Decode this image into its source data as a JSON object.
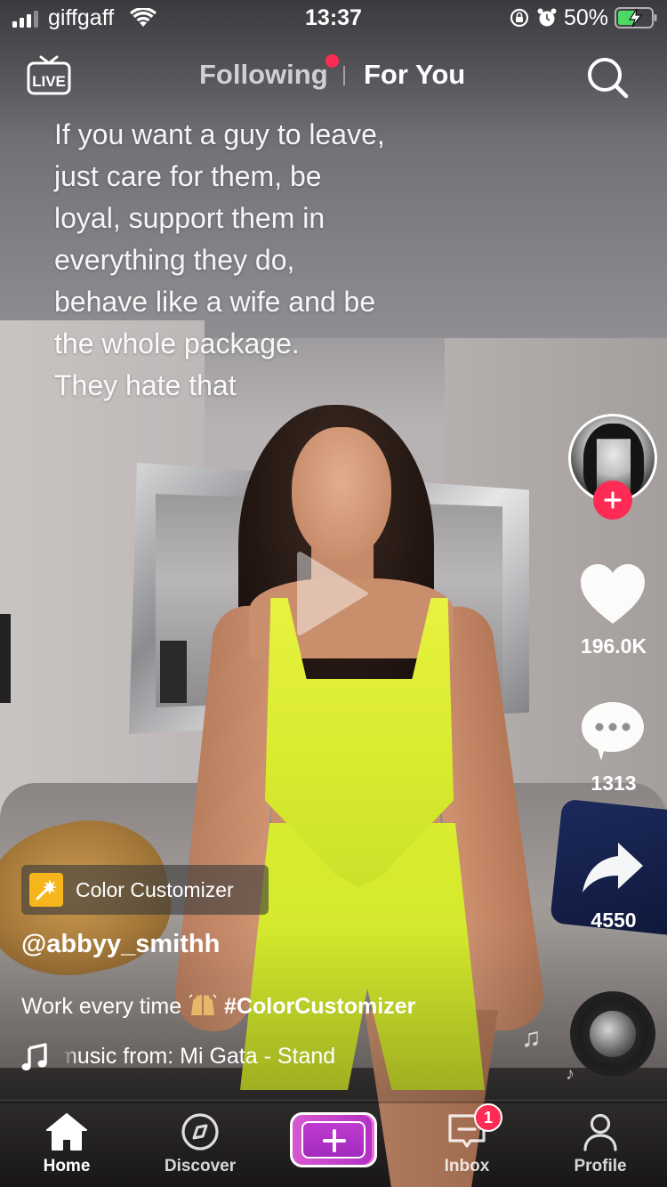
{
  "status_bar": {
    "carrier": "giffgaff",
    "time": "13:37",
    "battery_percent": "50%",
    "signal_bars": 3,
    "signal_total": 4
  },
  "top_nav": {
    "live_label": "LIVE",
    "following_label": "Following",
    "for_you_label": "For You",
    "active_tab": "For You"
  },
  "video": {
    "overlay_text": "If you want a guy to leave,\njust care for them, be\nloyal, support them in\neverything they do,\nbehave like a wife and be\nthe whole package.\nThey hate that"
  },
  "actions": {
    "likes": "196.0K",
    "comments": "1313",
    "shares": "4550"
  },
  "post": {
    "effect_name": "Color Customizer",
    "username": "@abbyy_smithh",
    "description_text": "Work every time",
    "hashtag": "#ColorCustomizer",
    "music_text": "music from: Mi Gata - Stand"
  },
  "tabbar": {
    "home_label": "Home",
    "discover_label": "Discover",
    "inbox_label": "Inbox",
    "profile_label": "Profile",
    "inbox_badge": "1",
    "active_tab": "Home"
  },
  "colors": {
    "accent_red": "#fe2c55",
    "effect_icon_bg": "#f6b61b",
    "create_button": "#c03bd0"
  },
  "icons": [
    "live-icon",
    "search-icon",
    "play-icon",
    "heart-icon",
    "comment-icon",
    "share-icon",
    "music-note-icon",
    "home-icon",
    "compass-icon",
    "plus-icon",
    "inbox-icon",
    "profile-icon",
    "wifi-icon",
    "lock-rotation-icon",
    "alarm-icon",
    "battery-icon"
  ]
}
